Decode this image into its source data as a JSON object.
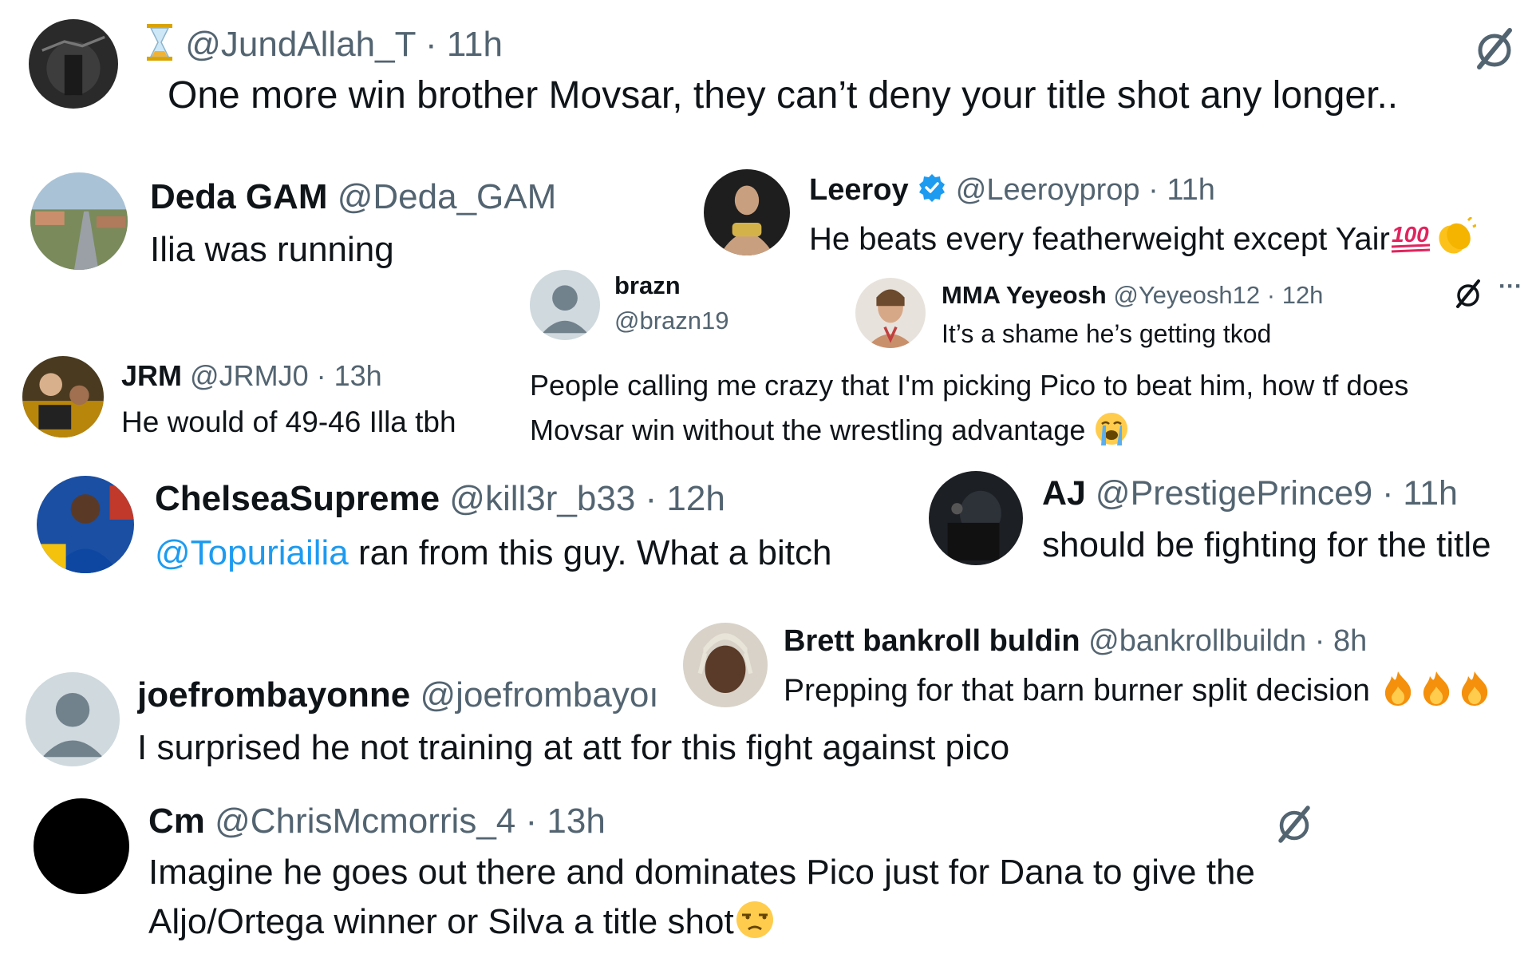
{
  "tweets": {
    "t1": {
      "handle": "@JundAllah_T",
      "dot": "·",
      "time": "11h",
      "text": "One more win brother Movsar, they can’t deny your title shot any longer.."
    },
    "t2": {
      "name": "Deda GAM",
      "handle": "@Deda_GAM",
      "text": "Ilia was running"
    },
    "t3": {
      "name": "Leeroy",
      "handle": "@Leeroyprop",
      "dot": "·",
      "time": "11h",
      "text": "He beats every featherweight except Yair"
    },
    "t4": {
      "name": "brazn",
      "handle": "@brazn19",
      "text1": "People calling me crazy that I'm picking Pico to beat him, how tf does",
      "text2": "Movsar win without the wrestling advantage"
    },
    "t5": {
      "name": "MMA Yeyeosh",
      "handle": "@Yeyeosh12",
      "dot": "·",
      "time": "12h",
      "text": "It’s a shame he’s getting tkod",
      "more": "···"
    },
    "t6": {
      "name": "JRM",
      "handle": "@JRMJ0",
      "dot": "·",
      "time": "13h",
      "text": "He would of 49-46 Illa tbh"
    },
    "t7": {
      "name": "ChelseaSupreme",
      "handle": "@kill3r_b33",
      "dot": "·",
      "time": "12h",
      "mention": "@Topuriailia",
      "text": " ran from this guy. What a bitch"
    },
    "t8": {
      "name": "AJ",
      "handle": "@PrestigePrince9",
      "dot": "·",
      "time": "11h",
      "text": "should be fighting for the title"
    },
    "t9": {
      "name": "Brett bankroll buldin",
      "handle": "@bankrollbuildn",
      "dot": "·",
      "time": "8h",
      "text": "Prepping for that barn burner split decision"
    },
    "t10": {
      "name": "joefrombayonne",
      "handle": "@joefrombayoı",
      "text": "I surprised he not training at att for this fight against pico"
    },
    "t11": {
      "name": "Cm",
      "handle": "@ChrisMcmorris_4",
      "dot": "·",
      "time": "13h",
      "text1": "Imagine he goes out there and dominates Pico just for Dana to give the",
      "text2": "Aljo/Ortega winner or Silva a title shot"
    }
  },
  "icons": {
    "hourglass": "hourglass-icon",
    "grok": "grok-slash-icon",
    "verified": "verified-badge-icon",
    "hundred": "hundred-points-emoji",
    "clap": "clapping-hands-emoji",
    "crying": "loudly-crying-emoji",
    "fire": "fire-emoji",
    "unamused": "unamused-face-emoji"
  },
  "colors": {
    "link": "#1d9bf0",
    "muted": "#536471",
    "text": "#0f1419"
  }
}
